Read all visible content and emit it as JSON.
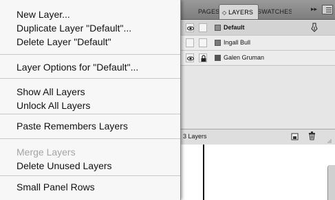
{
  "menu": {
    "sections": [
      {
        "items": [
          {
            "label": "New Layer...",
            "enabled": true
          },
          {
            "label": "Duplicate Layer \"Default\"...",
            "enabled": true
          },
          {
            "label": "Delete Layer \"Default\"",
            "enabled": true
          }
        ]
      },
      {
        "items": [
          {
            "label": "Layer Options for \"Default\"...",
            "enabled": true
          }
        ]
      },
      {
        "items": [
          {
            "label": "Show All Layers",
            "enabled": true
          },
          {
            "label": "Unlock All Layers",
            "enabled": true
          }
        ]
      },
      {
        "items": [
          {
            "label": "Paste Remembers Layers",
            "enabled": true
          }
        ]
      },
      {
        "items": [
          {
            "label": "Merge Layers",
            "enabled": false
          },
          {
            "label": "Delete Unused Layers",
            "enabled": true
          }
        ]
      },
      {
        "items": [
          {
            "label": "Small Panel Rows",
            "enabled": true
          }
        ]
      }
    ]
  },
  "panel": {
    "tabs": {
      "pages": "PAGES",
      "layers_arrows": "◇",
      "layers": "LAYERS",
      "swatches": "SWATCHES",
      "collapse": "▸▸"
    },
    "layers": [
      {
        "name": "Default",
        "visible": true,
        "locked": false,
        "color": "#8c8c8c",
        "selected": true,
        "icon": "pen-icon"
      },
      {
        "name": "Ingall Bull",
        "visible": false,
        "locked": false,
        "color": "#7a7a7a",
        "selected": false
      },
      {
        "name": "Galen Gruman",
        "visible": true,
        "locked": true,
        "color": "#555555",
        "selected": false
      }
    ],
    "footer": {
      "count": "3 Layers"
    }
  }
}
